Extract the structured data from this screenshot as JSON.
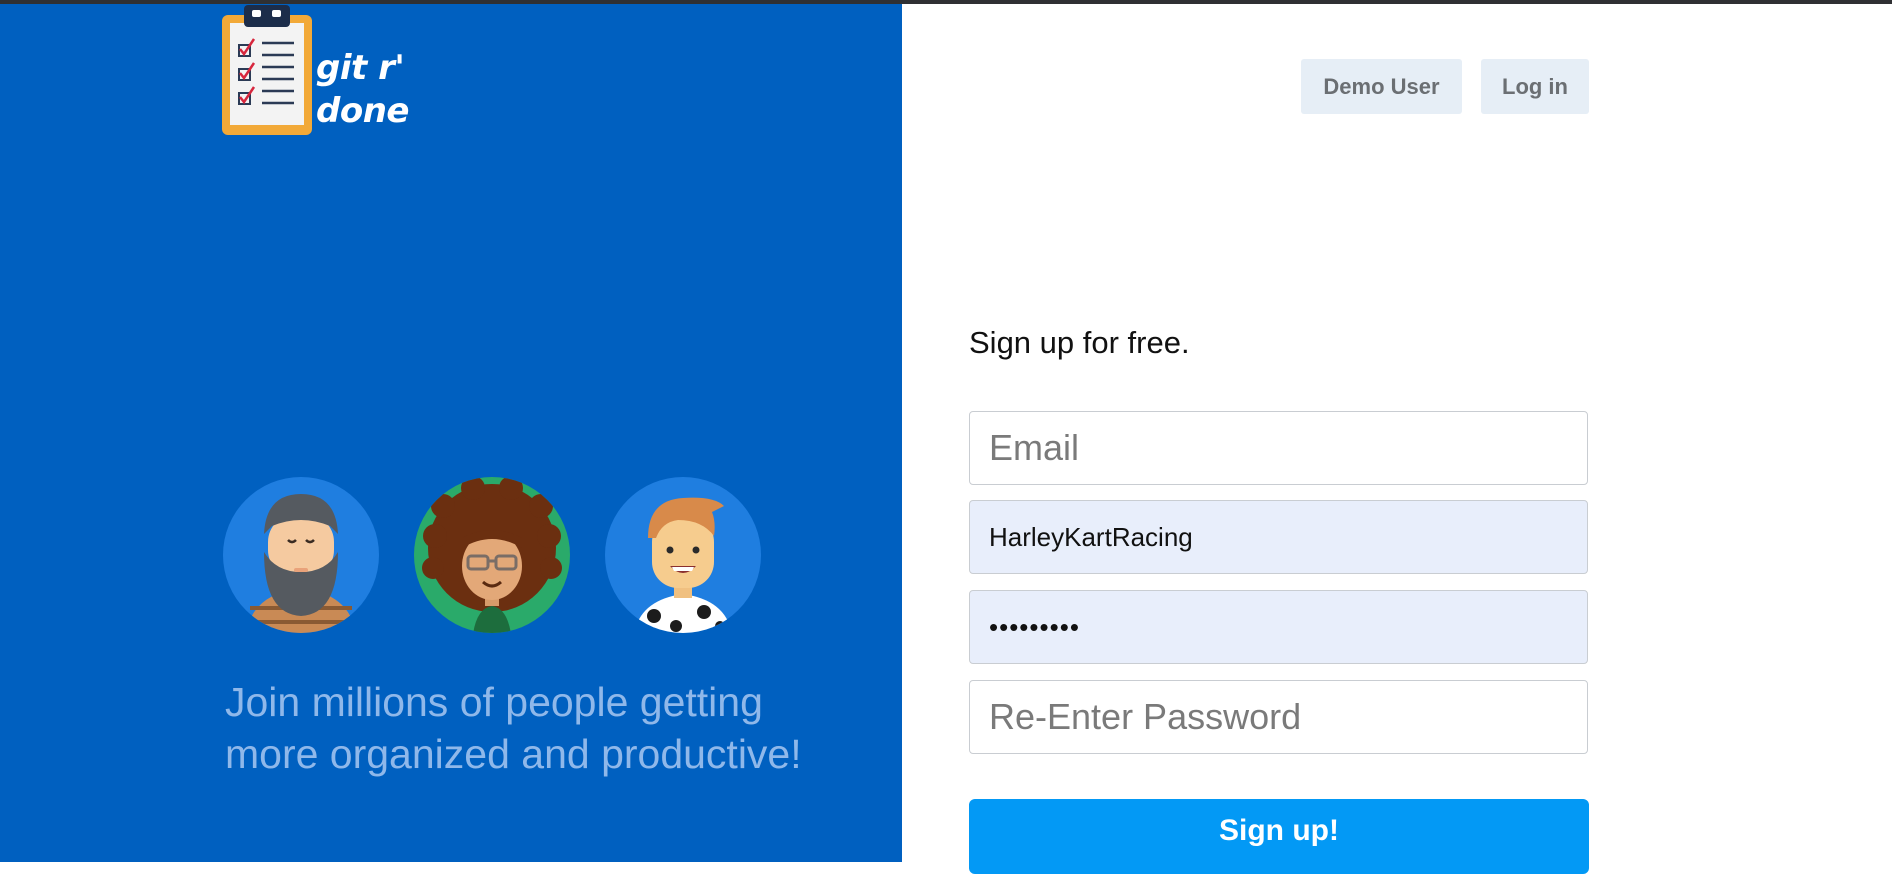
{
  "brand": {
    "name_line1": "git r'",
    "name_line2": "done",
    "logo_icon": "clipboard-checklist-icon"
  },
  "header": {
    "demo_user_label": "Demo User",
    "login_label": "Log in"
  },
  "hero": {
    "avatars": [
      "bearded-man-avatar",
      "curly-hair-glasses-avatar",
      "smiling-man-avatar"
    ],
    "tagline_line1": "Join millions of people getting",
    "tagline_line2": "more organized and productive!"
  },
  "signup": {
    "title": "Sign up for free.",
    "email": {
      "placeholder": "Email",
      "value": ""
    },
    "username": {
      "value": "HarleyKartRacing"
    },
    "password": {
      "value": "•••••••••"
    },
    "reenter_password": {
      "placeholder": "Re-Enter Password",
      "value": ""
    },
    "submit_label": "Sign up!"
  },
  "colors": {
    "left_panel_bg": "#0060c0",
    "tagline": "#8fb8ea",
    "primary_button": "#0399f5",
    "secondary_button_bg": "#e6eef6",
    "autofill_bg": "#e8eefb"
  }
}
